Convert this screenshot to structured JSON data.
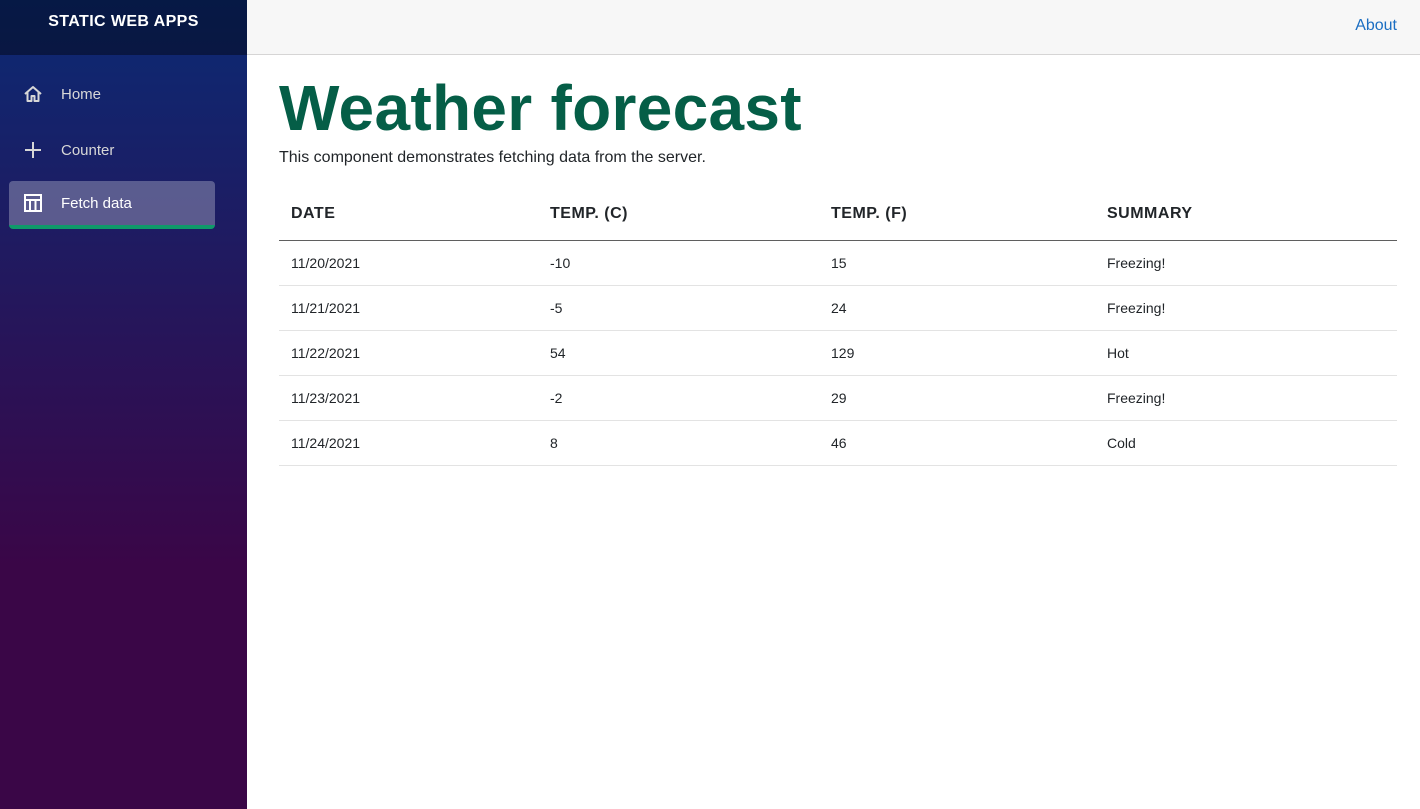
{
  "app": {
    "title": "STATIC WEB APPS"
  },
  "sidebar": {
    "items": [
      {
        "label": "Home",
        "icon": "home-icon"
      },
      {
        "label": "Counter",
        "icon": "plus-icon"
      },
      {
        "label": "Fetch data",
        "icon": "table-icon",
        "active": true
      }
    ]
  },
  "header": {
    "about_label": "About"
  },
  "main": {
    "title": "Weather forecast",
    "intro": "This component demonstrates fetching data from the server.",
    "table": {
      "headers": [
        "DATE",
        "TEMP. (C)",
        "TEMP. (F)",
        "SUMMARY"
      ],
      "rows": [
        [
          "11/20/2021",
          "-10",
          "15",
          "Freezing!"
        ],
        [
          "11/21/2021",
          "-5",
          "24",
          "Freezing!"
        ],
        [
          "11/22/2021",
          "54",
          "129",
          "Hot"
        ],
        [
          "11/23/2021",
          "-2",
          "29",
          "Freezing!"
        ],
        [
          "11/24/2021",
          "8",
          "46",
          "Cold"
        ]
      ]
    }
  },
  "colors": {
    "title_green": "#055e47",
    "link_blue": "#1b6ec2",
    "active_underline": "#0f9a6a"
  }
}
